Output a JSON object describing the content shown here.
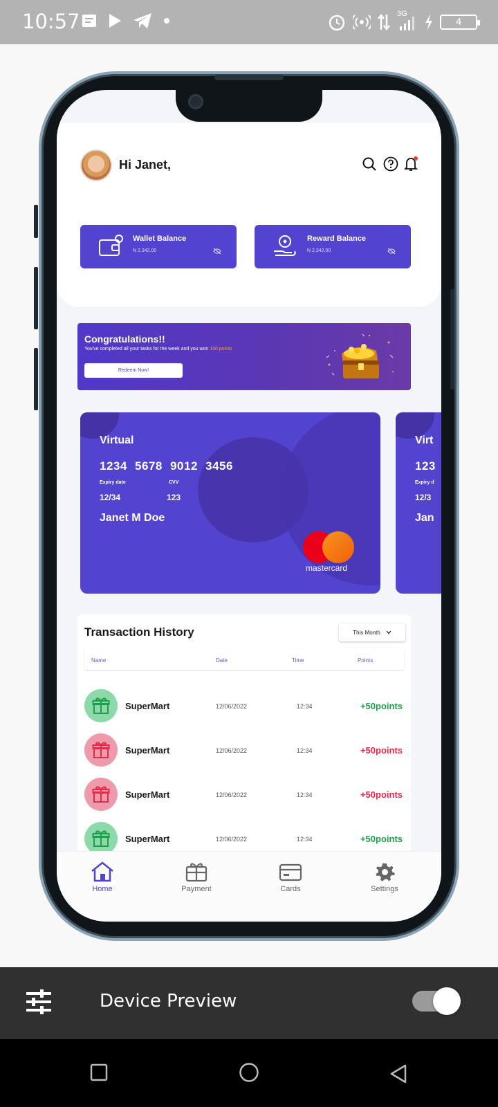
{
  "status_bar": {
    "time": "10:57",
    "network": "3G",
    "battery": "4"
  },
  "header": {
    "greeting": "Hi Janet,"
  },
  "balances": [
    {
      "label": "Wallet Balance",
      "amount": "N 2,342.00",
      "icon": "wallet-icon"
    },
    {
      "label": "Reward Balance",
      "amount": "N 2,342.00",
      "icon": "reward-hand-icon"
    }
  ],
  "banner": {
    "title": "Congratulations!!",
    "text_before": "You've completed all your tasks for the week and you won ",
    "highlight": "150 points",
    "button": "Redeem Now!"
  },
  "cards": [
    {
      "type": "Virtual",
      "number": "1234  5678  9012  3456",
      "expiry_label": "Expiry date",
      "expiry": "12/34",
      "cvv_label": "CVV",
      "cvv": "123",
      "holder": "Janet M Doe",
      "brand": "mastercard"
    },
    {
      "type": "Virt",
      "number": "123",
      "expiry_label": "Expiry d",
      "expiry": "12/3",
      "holder": "Jan"
    }
  ],
  "transactions": {
    "title": "Transaction History",
    "filter": "This Month",
    "columns": [
      "Name",
      "Date",
      "Time",
      "Points"
    ],
    "rows": [
      {
        "name": "SuperMart",
        "date": "12/06/2022",
        "time": "12:34",
        "points": "+50points",
        "status": "green"
      },
      {
        "name": "SuperMart",
        "date": "12/06/2022",
        "time": "12:34",
        "points": "+50points",
        "status": "red"
      },
      {
        "name": "SuperMart",
        "date": "12/06/2022",
        "time": "12:34",
        "points": "+50points",
        "status": "red"
      },
      {
        "name": "SuperMart",
        "date": "12/06/2022",
        "time": "12:34",
        "points": "+50points",
        "status": "green"
      }
    ]
  },
  "nav": {
    "home": "Home",
    "payment": "Payment",
    "cards": "Cards",
    "settings": "Settings"
  },
  "preview": {
    "label": "Device Preview",
    "toggle_on": true
  },
  "colors": {
    "accent": "#5244cf",
    "positive": "#1e9e4a",
    "negative": "#e5294a"
  }
}
